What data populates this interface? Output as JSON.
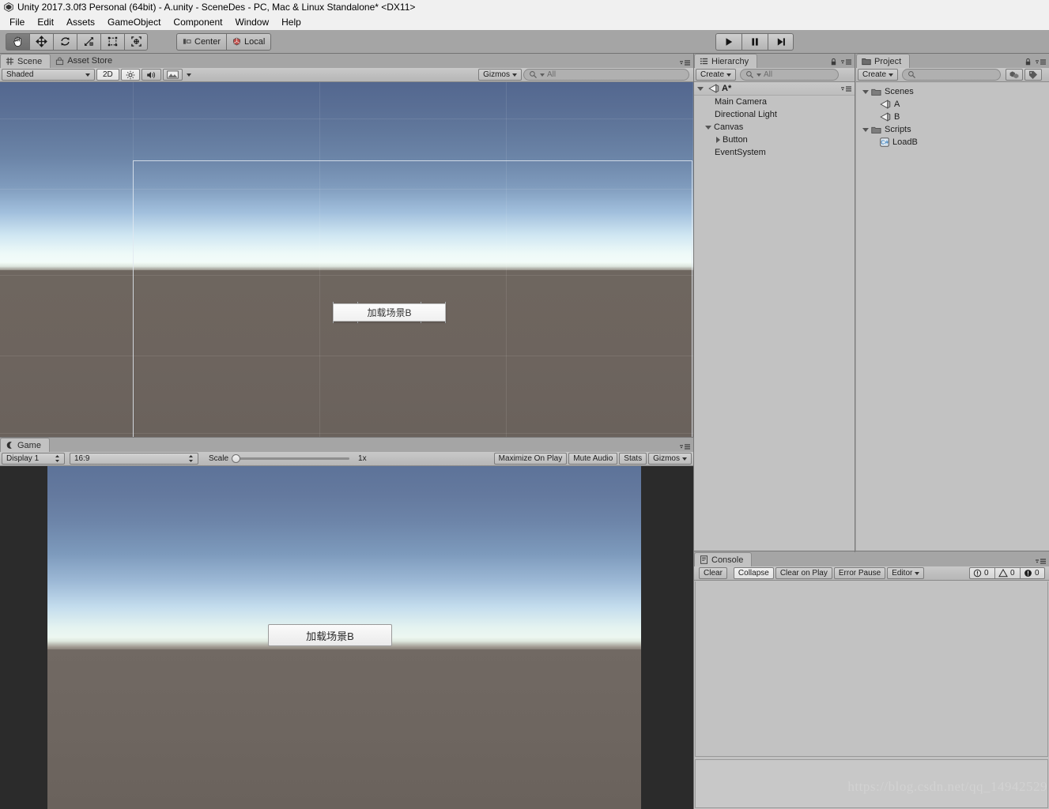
{
  "window": {
    "title": "Unity 2017.3.0f3 Personal (64bit) - A.unity - SceneDes - PC, Mac & Linux Standalone* <DX11>",
    "app_icon": "unity-icon"
  },
  "menubar": {
    "items": [
      {
        "label": "File"
      },
      {
        "label": "Edit"
      },
      {
        "label": "Assets"
      },
      {
        "label": "GameObject"
      },
      {
        "label": "Component"
      },
      {
        "label": "Window"
      },
      {
        "label": "Help"
      }
    ]
  },
  "toolbar": {
    "tools": [
      {
        "name": "hand-tool",
        "icon": "hand-icon",
        "active": true
      },
      {
        "name": "move-tool",
        "icon": "move-icon",
        "active": false
      },
      {
        "name": "rotate-tool",
        "icon": "rotate-icon",
        "active": false
      },
      {
        "name": "scale-tool",
        "icon": "scale-icon",
        "active": false
      },
      {
        "name": "rect-tool",
        "icon": "rect-icon",
        "active": false
      },
      {
        "name": "transform-tool",
        "icon": "transform-icon",
        "active": false
      }
    ],
    "pivot_mode": "Center",
    "pivot_rotation": "Local",
    "play_controls": [
      {
        "name": "play-button",
        "icon": "play-icon"
      },
      {
        "name": "pause-button",
        "icon": "pause-icon"
      },
      {
        "name": "step-button",
        "icon": "step-icon"
      }
    ]
  },
  "scene_view": {
    "tabs": [
      {
        "label": "Scene",
        "icon": "scene-icon",
        "active": true
      },
      {
        "label": "Asset Store",
        "icon": "store-icon",
        "active": false
      }
    ],
    "draw_mode": "Shaded",
    "two_d_label": "2D",
    "gizmos_label": "Gizmos",
    "search_placeholder": "All",
    "search_value": "",
    "ui_button_label": "加载场景B"
  },
  "game_view": {
    "tab_label": "Game",
    "tab_icon": "game-icon",
    "display": "Display 1",
    "aspect": "16:9",
    "scale_label": "Scale",
    "scale_value": "1x",
    "maximize_on_play": "Maximize On Play",
    "mute_audio": "Mute Audio",
    "stats": "Stats",
    "gizmos": "Gizmos",
    "ui_button_label": "加载场景B"
  },
  "hierarchy": {
    "tab_label": "Hierarchy",
    "tab_icon": "hierarchy-icon",
    "create_label": "Create",
    "search_placeholder": "All",
    "search_value": "",
    "scene_name": "A*",
    "items": [
      {
        "label": "Main Camera",
        "depth": 1,
        "expandable": false,
        "expanded": false
      },
      {
        "label": "Directional Light",
        "depth": 1,
        "expandable": false,
        "expanded": false
      },
      {
        "label": "Canvas",
        "depth": 1,
        "expandable": true,
        "expanded": true
      },
      {
        "label": "Button",
        "depth": 2,
        "expandable": true,
        "expanded": false
      },
      {
        "label": "EventSystem",
        "depth": 1,
        "expandable": false,
        "expanded": false
      }
    ]
  },
  "project": {
    "tab_label": "Project",
    "tab_icon": "folder-icon",
    "create_label": "Create",
    "search_placeholder": "",
    "search_value": "",
    "items": [
      {
        "label": "Scenes",
        "depth": 0,
        "kind": "folder",
        "expandable": true,
        "expanded": true
      },
      {
        "label": "A",
        "depth": 1,
        "kind": "scene",
        "expandable": false,
        "expanded": false
      },
      {
        "label": "B",
        "depth": 1,
        "kind": "scene",
        "expandable": false,
        "expanded": false
      },
      {
        "label": "Scripts",
        "depth": 0,
        "kind": "folder",
        "expandable": true,
        "expanded": true
      },
      {
        "label": "LoadB",
        "depth": 1,
        "kind": "script",
        "expandable": false,
        "expanded": false
      }
    ]
  },
  "console": {
    "tab_label": "Console",
    "tab_icon": "console-icon",
    "clear_label": "Clear",
    "collapse_label": "Collapse",
    "clear_on_play_label": "Clear on Play",
    "error_pause_label": "Error Pause",
    "editor_label": "Editor",
    "counts": {
      "info": "0",
      "warning": "0",
      "error": "0"
    }
  },
  "watermark": "https://blog.csdn.net/qq_14942529",
  "colors": {
    "chrome": "#a5a5a5",
    "panel": "#c2c2c2",
    "titlebar": "#f0f0f0",
    "sky_top": "#53678f",
    "ground": "#6d645e",
    "letterbox": "#2b2b2b"
  }
}
